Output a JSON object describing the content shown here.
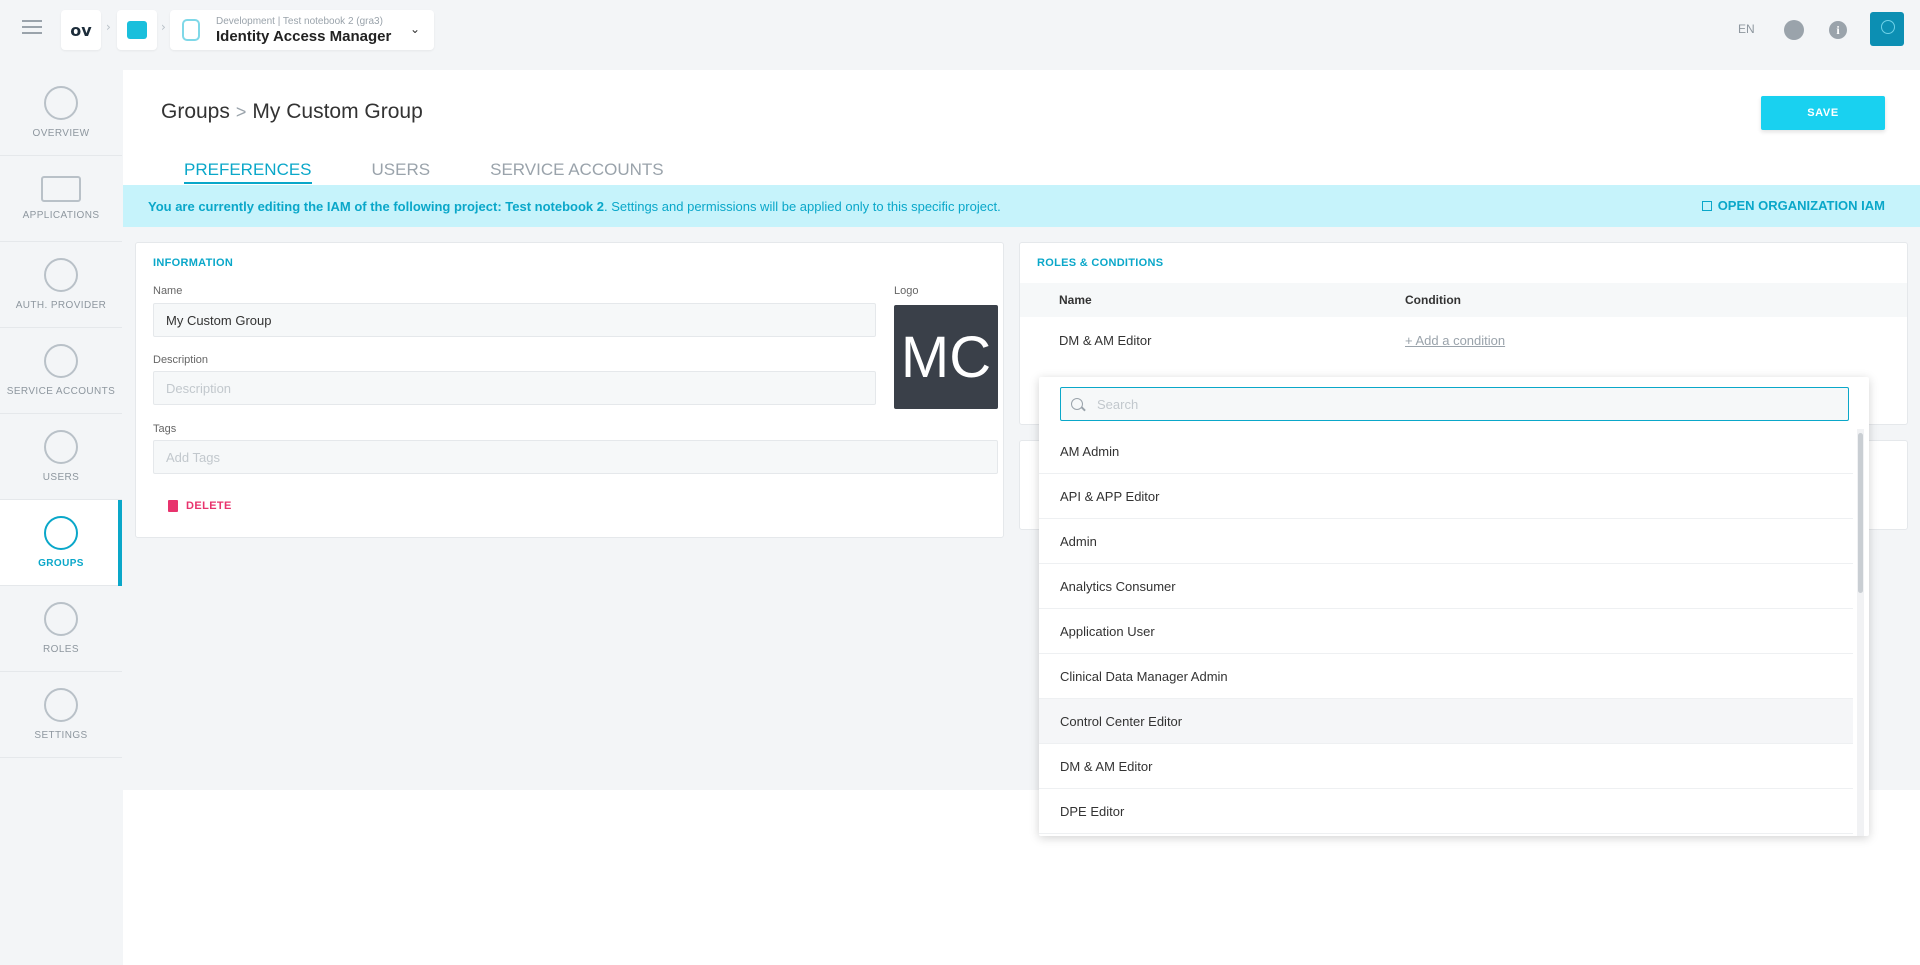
{
  "topbar": {
    "logo_text": "ov",
    "app_subtitle": "Development | Test notebook 2 (gra3)",
    "app_title": "Identity Access Manager",
    "lang": "EN",
    "info_glyph": "i",
    "separator": "›",
    "chevron": "⌄"
  },
  "sidebar": {
    "items": [
      {
        "label": "OVERVIEW",
        "icon": "gauge-icon"
      },
      {
        "label": "APPLICATIONS",
        "icon": "laptop-icon"
      },
      {
        "label": "AUTH. PROVIDER",
        "icon": "key-icon"
      },
      {
        "label": "SERVICE ACCOUNTS",
        "icon": "robot-icon"
      },
      {
        "label": "USERS",
        "icon": "user-icon"
      },
      {
        "label": "GROUPS",
        "icon": "groups-icon"
      },
      {
        "label": "ROLES",
        "icon": "pencil-icon"
      },
      {
        "label": "SETTINGS",
        "icon": "gear-icon"
      }
    ],
    "active": "GROUPS"
  },
  "header": {
    "breadcrumb_root": "Groups",
    "breadcrumb_sep": ">",
    "breadcrumb_current": "My Custom Group",
    "save_label": "SAVE"
  },
  "tabs": [
    "PREFERENCES",
    "USERS",
    "SERVICE ACCOUNTS"
  ],
  "notice": {
    "bold": "You are currently editing the IAM of the following project: Test notebook 2",
    "rest": ". Settings and permissions will be applied only to this specific project.",
    "link": "OPEN ORGANIZATION IAM"
  },
  "information": {
    "title": "INFORMATION",
    "name_label": "Name",
    "name_value": "My Custom Group",
    "logo_label": "Logo",
    "logo_initials": "MC",
    "description_label": "Description",
    "description_placeholder": "Description",
    "tags_label": "Tags",
    "tags_placeholder": "Add Tags",
    "delete_label": "DELETE"
  },
  "roles": {
    "title": "ROLES & CONDITIONS",
    "col_name": "Name",
    "col_condition": "Condition",
    "row_name": "DM & AM Editor",
    "add_condition": "+ Add a condition"
  },
  "dropdown": {
    "search_placeholder": "Search",
    "items": [
      "AM Admin",
      "API & APP Editor",
      "Admin",
      "Analytics Consumer",
      "Application User",
      "Clinical Data Manager Admin",
      "Control Center Editor",
      "DM & AM Editor",
      "DPE Editor"
    ],
    "hover_item": "Control Center Editor"
  }
}
